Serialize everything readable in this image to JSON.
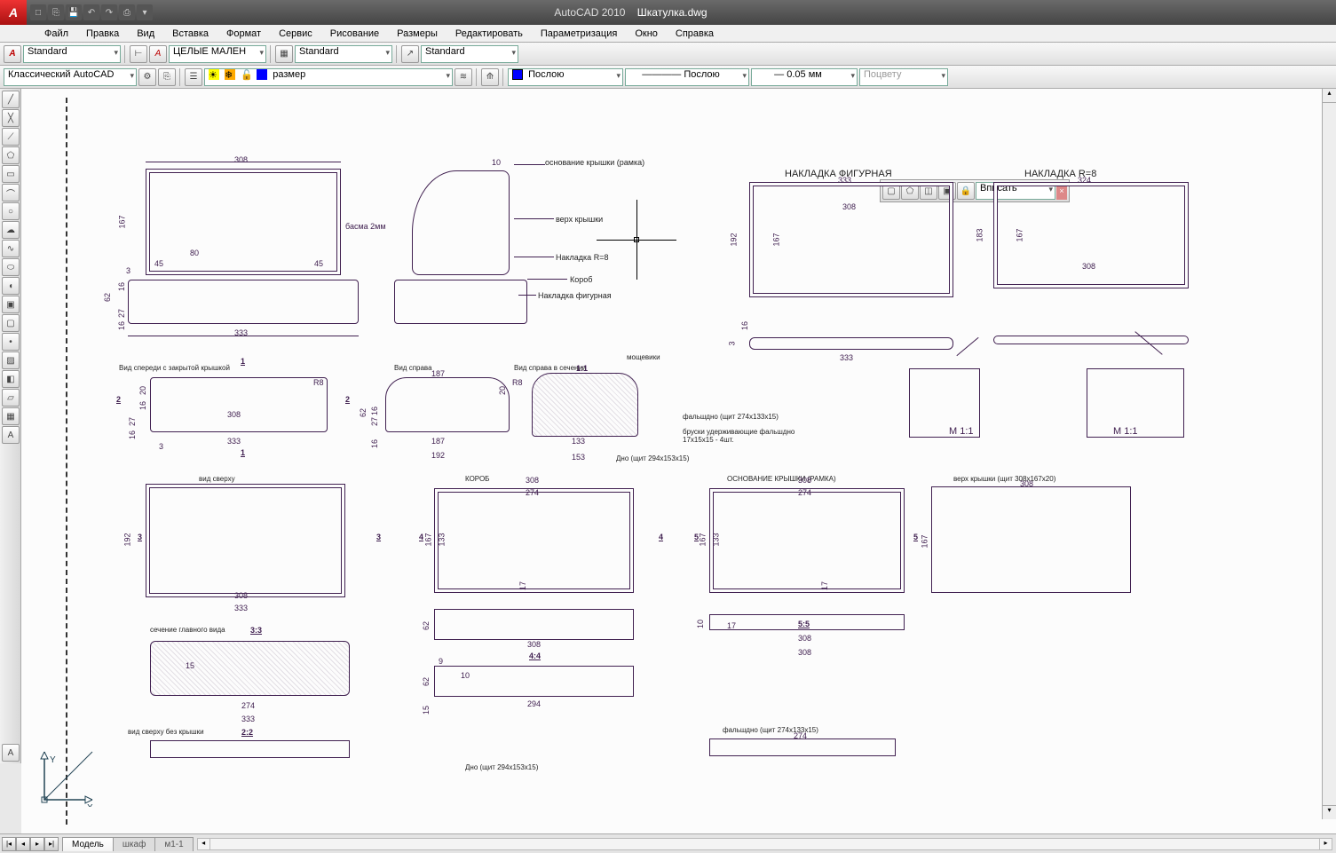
{
  "titlebar": {
    "app": "AutoCAD 2010",
    "file": "Шкатулка.dwg",
    "logo": "A"
  },
  "menu": [
    "Файл",
    "Правка",
    "Вид",
    "Вставка",
    "Формат",
    "Сервис",
    "Рисование",
    "Размеры",
    "Редактировать",
    "Параметризация",
    "Окно",
    "Справка"
  ],
  "tb1": {
    "text_style": "Standard",
    "dim_style": "ЦЕЛЫЕ МАЛЕН",
    "table_style": "Standard",
    "ml_style": "Standard"
  },
  "tb2": {
    "workspace": "Классический AutoCAD",
    "layer": "размер",
    "color": "Послою",
    "lineweight": "0.05 мм",
    "linetype": "Послою",
    "plotstyle": "Поцвету"
  },
  "viewport": {
    "fit": "Вписать"
  },
  "float_right": {
    "style": "Standard"
  },
  "tabs": {
    "model": "Модель",
    "layout1": "шкаф",
    "layout2": "м1-1"
  },
  "drawing": {
    "title1": "НАКЛАДКА ФИГУРНАЯ",
    "title2": "НАКЛАДКА R=8",
    "lbl_osn": "основание крышки (рамка)",
    "lbl_verh": "верх крышки",
    "lbl_nakl_r8": "Накладка R=8",
    "lbl_korob": "Короб",
    "lbl_nakl_fig": "Накладка фигурная",
    "lbl_basma": "басма 2мм",
    "lbl_mosch": "мощевики",
    "lbl_falsh": "фальшдно (щит 274x133x15)",
    "lbl_brus": "бруски удерживающие фальшдно 17x15x15 - 4шт.",
    "lbl_dno": "Дно (щит 294x153x15)",
    "lbl_vid_speredi": "Вид спереди с закрытой крышкой",
    "lbl_vid_sprava": "Вид справа",
    "lbl_vid_sprava_sech": "Вид справа в сечении",
    "lbl_vid_sverhu": "вид сверху",
    "lbl_sech_glav": "сечение главного вида",
    "lbl_vid_sverhu_bez": "вид сверху без крышки",
    "lbl_korob2": "КОРОБ",
    "lbl_osn2": "ОСНОВАНИЕ КРЫШКИ (РАМКА)",
    "lbl_verh2": "верх крышки (щит 308x167x20)",
    "lbl_falsh2": "фальшдно (щит 274x133x15)",
    "lbl_dno2": "Дно (щит 294x153x15)",
    "scale_11": "1:1",
    "scale_m11": "M 1:1",
    "scale_33": "3:3",
    "scale_22": "2:2",
    "scale_44": "4:4",
    "scale_55": "5:5",
    "d308": "308",
    "d333": "333",
    "d167": "167",
    "d192": "192",
    "d324": "324",
    "d183": "183",
    "d274": "274",
    "d294": "294",
    "d133": "133",
    "d153": "153",
    "d62": "62",
    "d16": "16",
    "d27": "27",
    "d3": "3",
    "d45": "45",
    "d80": "80",
    "d10": "10",
    "d17": "17",
    "d15": "15",
    "d20": "20",
    "d187": "187",
    "d9": "9",
    "n1": "1",
    "n2": "2",
    "n3": "3",
    "n4": "4",
    "n5": "5",
    "r8": "R8"
  }
}
